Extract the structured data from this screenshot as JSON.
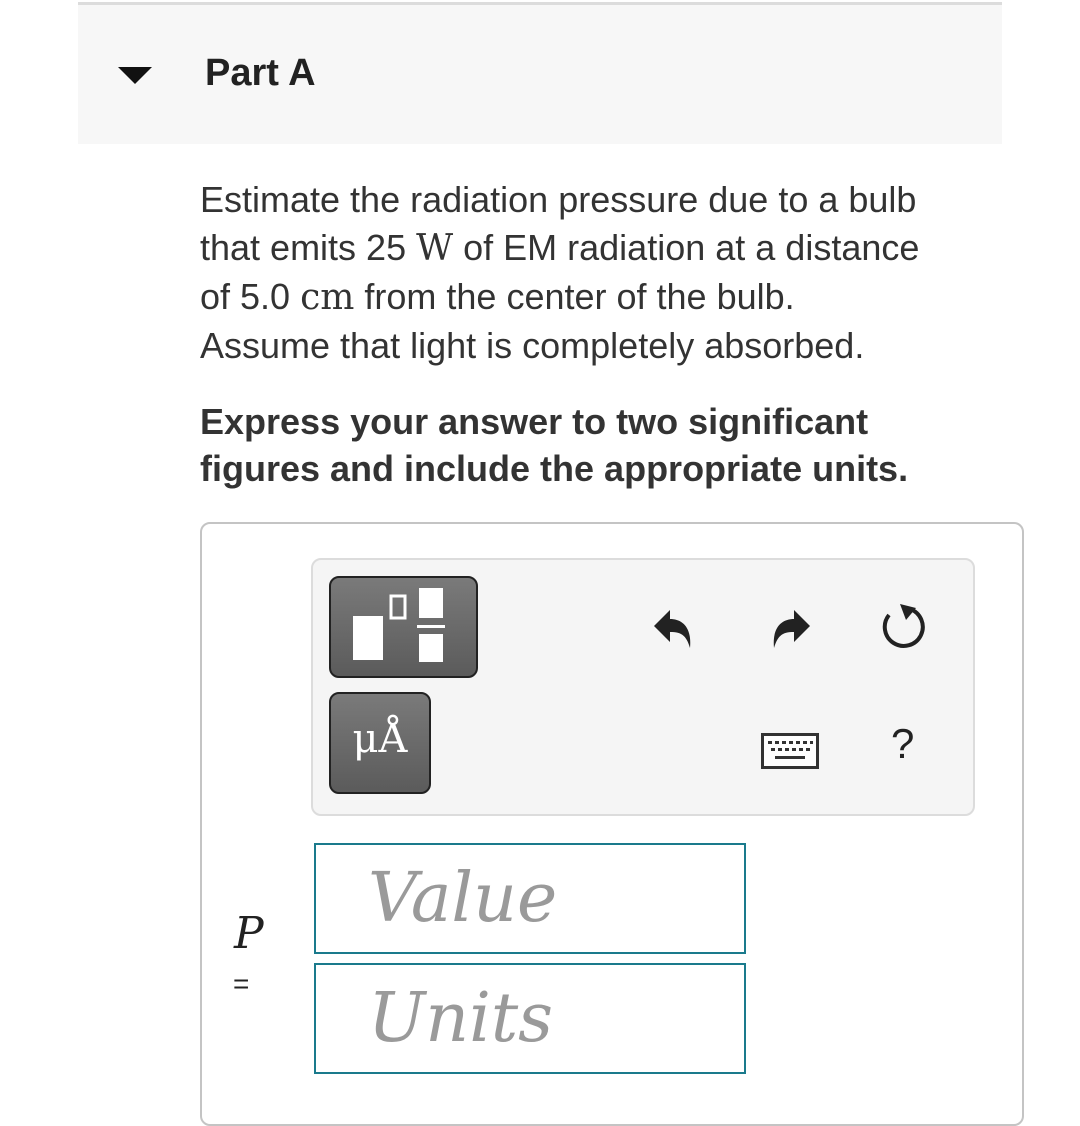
{
  "part": {
    "title": "Part A"
  },
  "question": {
    "line1": "Estimate the radiation pressure due to a bulb",
    "line2_pre": "that emits 25 ",
    "power_unit": "W",
    "line2_post": " of EM radiation at a distance",
    "line3_pre": "of 5.0 ",
    "distance_unit": "cm",
    "line3_post": " from the center of the bulb.",
    "line4": "Assume that light is completely absorbed."
  },
  "instruction": {
    "line1": "Express your answer to two significant",
    "line2": "figures and include the appropriate units."
  },
  "toolbar": {
    "units_label": "μÅ",
    "help_label": "?",
    "icons": [
      "templates-icon",
      "undo-icon",
      "redo-icon",
      "reset-icon",
      "units-icon",
      "keyboard-icon",
      "help-icon"
    ]
  },
  "answer": {
    "variable": "P",
    "equals": "=",
    "value_placeholder": "Value",
    "value": "",
    "units_placeholder": "Units",
    "units": ""
  },
  "colors": {
    "header_bg": "#f7f7f7",
    "field_border": "#1a7a8c",
    "tool_button": "#6b6b6b",
    "toolbar_bg": "#f5f5f5"
  }
}
